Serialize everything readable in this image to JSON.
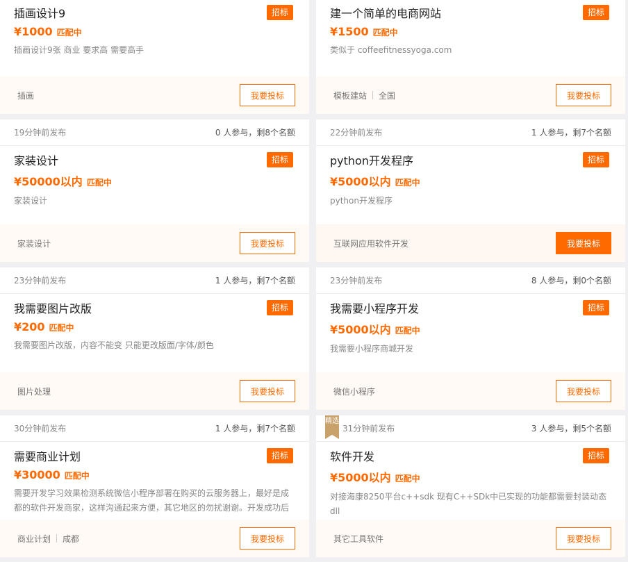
{
  "bid_label": "招标",
  "match_label": "匹配中",
  "submit_label": "我要投标",
  "cards": [
    {
      "time": "",
      "participants": "",
      "title": "插画设计9",
      "price": "¥1000",
      "desc": [
        "插画设计9张 商业 要求高 需要高手"
      ],
      "tags": [
        "插画"
      ]
    },
    {
      "time": "",
      "participants": "",
      "title": "建一个简单的电商网站",
      "price": "¥1500",
      "desc": [
        "类似于 coffeefitnessyoga.com"
      ],
      "tags": [
        "模板建站",
        "全国"
      ]
    },
    {
      "time": "19分钟前发布",
      "participants": "0 人参与，剩8个名额",
      "title": "家装设计",
      "price": "¥50000以内",
      "desc": [
        "家装设计"
      ],
      "tags": [
        "家装设计"
      ]
    },
    {
      "time": "22分钟前发布",
      "participants": "1 人参与，剩7个名额",
      "title": "python开发程序",
      "price": "¥5000以内",
      "desc": [
        "python开发程序"
      ],
      "tags": [
        "互联网应用软件开发"
      ]
    },
    {
      "time": "23分钟前发布",
      "participants": "1 人参与，剩7个名额",
      "title": "我需要图片改版",
      "price": "¥200",
      "desc": [
        "我需要图片改版，内容不能变 只能更改版面/字体/颜色"
      ],
      "tags": [
        "图片处理"
      ]
    },
    {
      "time": "23分钟前发布",
      "participants": "8 人参与，剩0个名额",
      "title": "我需要小程序开发",
      "price": "¥5000以内",
      "desc": [
        "我需要小程序商城开发"
      ],
      "tags": [
        "微信小程序"
      ]
    },
    {
      "time": "30分钟前发布",
      "participants": "1 人参与，剩7个名额",
      "title": "需要商业计划",
      "price": "¥30000",
      "desc": [
        "需要开发学习效果检测系统微信小程序部署在购买的云服务器上，最好是成",
        "都的软件开发商家，这样沟通起来方便，其它地区的勿扰谢谢。开发成功后"
      ],
      "tags": [
        "商业计划",
        "成都"
      ]
    },
    {
      "time": "31分钟前发布",
      "participants": "3 人参与，剩5个名额",
      "title": "软件开发",
      "price": "¥5000以内",
      "desc": [
        "对接海康8250平台c++sdk 现有C++SDk中已实现的功能都需要封装动态dll"
      ],
      "tags": [
        "其它工具软件"
      ],
      "badge": "精选"
    }
  ]
}
